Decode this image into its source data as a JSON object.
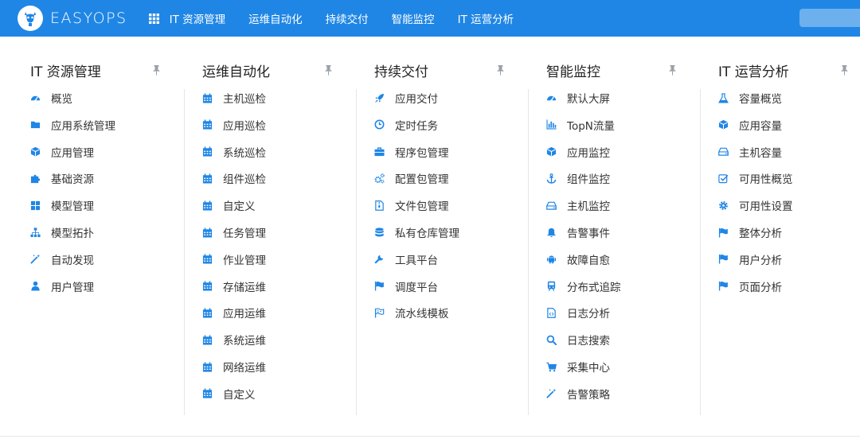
{
  "brand": {
    "name": "EASYOPS"
  },
  "nav": [
    "IT 资源管理",
    "运维自动化",
    "持续交付",
    "智能监控",
    "IT 运营分析"
  ],
  "colors": {
    "header": "#1f86e5",
    "icon": "#1f86e5",
    "pin": "#9aa0a6"
  },
  "columns": [
    {
      "title": "IT 资源管理",
      "items": [
        {
          "label": "概览",
          "icon": "dashboard-icon"
        },
        {
          "label": "应用系统管理",
          "icon": "folder-icon"
        },
        {
          "label": "应用管理",
          "icon": "cube-icon"
        },
        {
          "label": "基础资源",
          "icon": "puzzle-icon"
        },
        {
          "label": "模型管理",
          "icon": "grid-icon"
        },
        {
          "label": "模型拓扑",
          "icon": "sitemap-icon"
        },
        {
          "label": "自动发现",
          "icon": "magic-wand-icon"
        },
        {
          "label": "用户管理",
          "icon": "user-icon"
        }
      ]
    },
    {
      "title": "运维自动化",
      "items": [
        {
          "label": "主机巡检",
          "icon": "calendar-icon"
        },
        {
          "label": "应用巡检",
          "icon": "calendar-icon"
        },
        {
          "label": "系统巡检",
          "icon": "calendar-icon"
        },
        {
          "label": "组件巡检",
          "icon": "calendar-icon"
        },
        {
          "label": "自定义",
          "icon": "calendar-icon"
        },
        {
          "label": "任务管理",
          "icon": "calendar-icon"
        },
        {
          "label": "作业管理",
          "icon": "calendar-icon"
        },
        {
          "label": "存储运维",
          "icon": "calendar-icon"
        },
        {
          "label": "应用运维",
          "icon": "calendar-icon"
        },
        {
          "label": "系统运维",
          "icon": "calendar-icon"
        },
        {
          "label": "网络运维",
          "icon": "calendar-icon"
        },
        {
          "label": "自定义",
          "icon": "calendar-icon"
        }
      ]
    },
    {
      "title": "持续交付",
      "items": [
        {
          "label": "应用交付",
          "icon": "rocket-icon"
        },
        {
          "label": "定时任务",
          "icon": "clock-icon"
        },
        {
          "label": "程序包管理",
          "icon": "briefcase-icon"
        },
        {
          "label": "配置包管理",
          "icon": "gears-icon"
        },
        {
          "label": "文件包管理",
          "icon": "file-archive-icon"
        },
        {
          "label": "私有仓库管理",
          "icon": "database-icon"
        },
        {
          "label": "工具平台",
          "icon": "wrench-icon"
        },
        {
          "label": "调度平台",
          "icon": "flag-icon"
        },
        {
          "label": "流水线模板",
          "icon": "flag-outline-icon"
        }
      ]
    },
    {
      "title": "智能监控",
      "items": [
        {
          "label": "默认大屏",
          "icon": "dashboard-icon"
        },
        {
          "label": "TopN流量",
          "icon": "bar-chart-icon"
        },
        {
          "label": "应用监控",
          "icon": "cube-icon"
        },
        {
          "label": "组件监控",
          "icon": "anchor-icon"
        },
        {
          "label": "主机监控",
          "icon": "hdd-icon"
        },
        {
          "label": "告警事件",
          "icon": "bell-icon"
        },
        {
          "label": "故障自愈",
          "icon": "android-icon"
        },
        {
          "label": "分布式追踪",
          "icon": "train-icon"
        },
        {
          "label": "日志分析",
          "icon": "file-code-icon"
        },
        {
          "label": "日志搜索",
          "icon": "search-icon"
        },
        {
          "label": "采集中心",
          "icon": "cart-icon"
        },
        {
          "label": "告警策略",
          "icon": "magic-wand-icon"
        }
      ]
    },
    {
      "title": "IT 运营分析",
      "items": [
        {
          "label": "容量概览",
          "icon": "flask-icon"
        },
        {
          "label": "应用容量",
          "icon": "cube-icon"
        },
        {
          "label": "主机容量",
          "icon": "hdd-icon"
        },
        {
          "label": "可用性概览",
          "icon": "check-square-icon"
        },
        {
          "label": "可用性设置",
          "icon": "gear-icon"
        },
        {
          "label": "整体分析",
          "icon": "flag-icon"
        },
        {
          "label": "用户分析",
          "icon": "flag-icon"
        },
        {
          "label": "页面分析",
          "icon": "flag-icon"
        }
      ]
    }
  ]
}
